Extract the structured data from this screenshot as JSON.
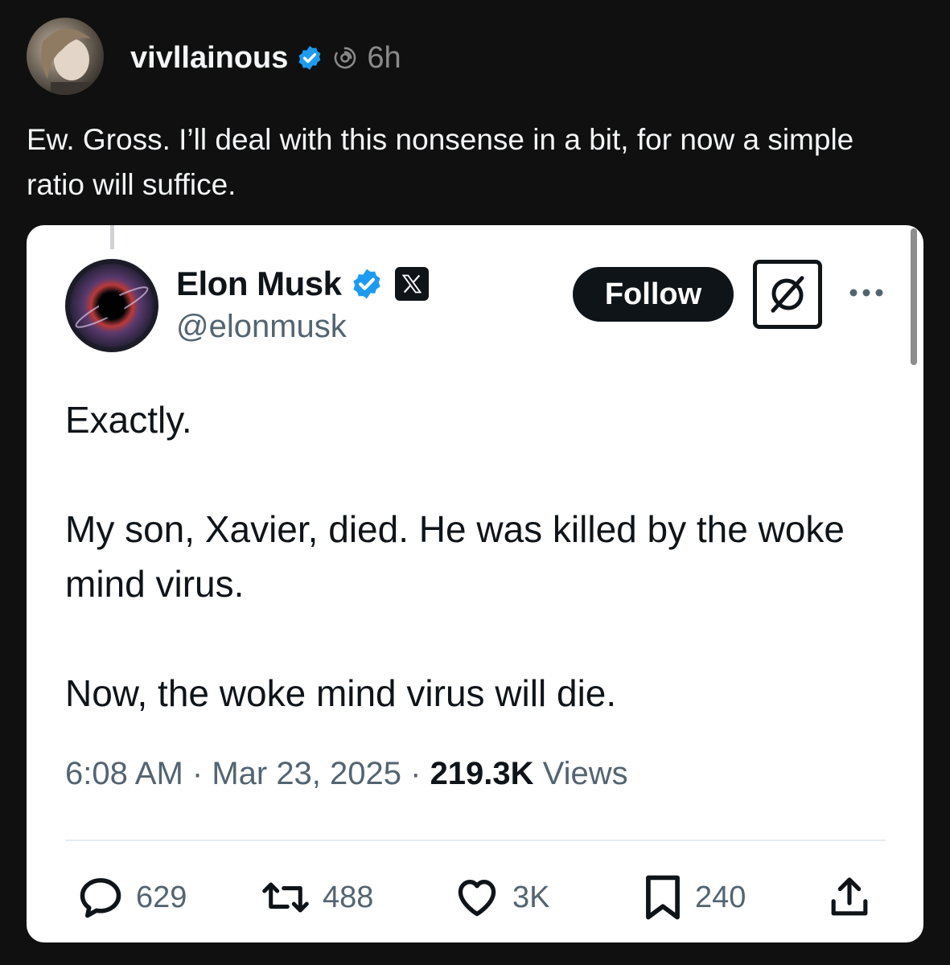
{
  "post": {
    "username": "vivllainous",
    "time_ago": "6h",
    "text": "Ew. Gross. I’ll deal with this nonsense in a bit, for now a simple ratio will suffice."
  },
  "quoted_tweet": {
    "author_name": "Elon Musk",
    "handle": "@elonmusk",
    "follow_label": "Follow",
    "paragraphs": [
      "Exactly.",
      "My son, Xavier, died. He was killed by the woke mind virus.",
      "Now, the woke mind virus will die."
    ],
    "time": "6:08 AM",
    "date": "Mar 23, 2025",
    "views_count": "219.3K",
    "views_label": "Views",
    "replies": "629",
    "reposts": "488",
    "likes": "3K",
    "bookmarks": "240"
  },
  "icons": {
    "verified": "verified-badge-icon",
    "thread_meta": "threads-swirl-icon",
    "x_logo": "x-logo-icon",
    "grok": "grok-icon",
    "more": "more-dots-icon",
    "reply": "reply-bubble-icon",
    "repost": "repost-icon",
    "like": "heart-icon",
    "bookmark": "bookmark-icon",
    "share": "share-upload-icon"
  },
  "colors": {
    "background": "#101010",
    "card": "#ffffff",
    "verified_blue": "#1d9bf0",
    "text_dark": "#0f1419",
    "text_muted": "#536471"
  }
}
